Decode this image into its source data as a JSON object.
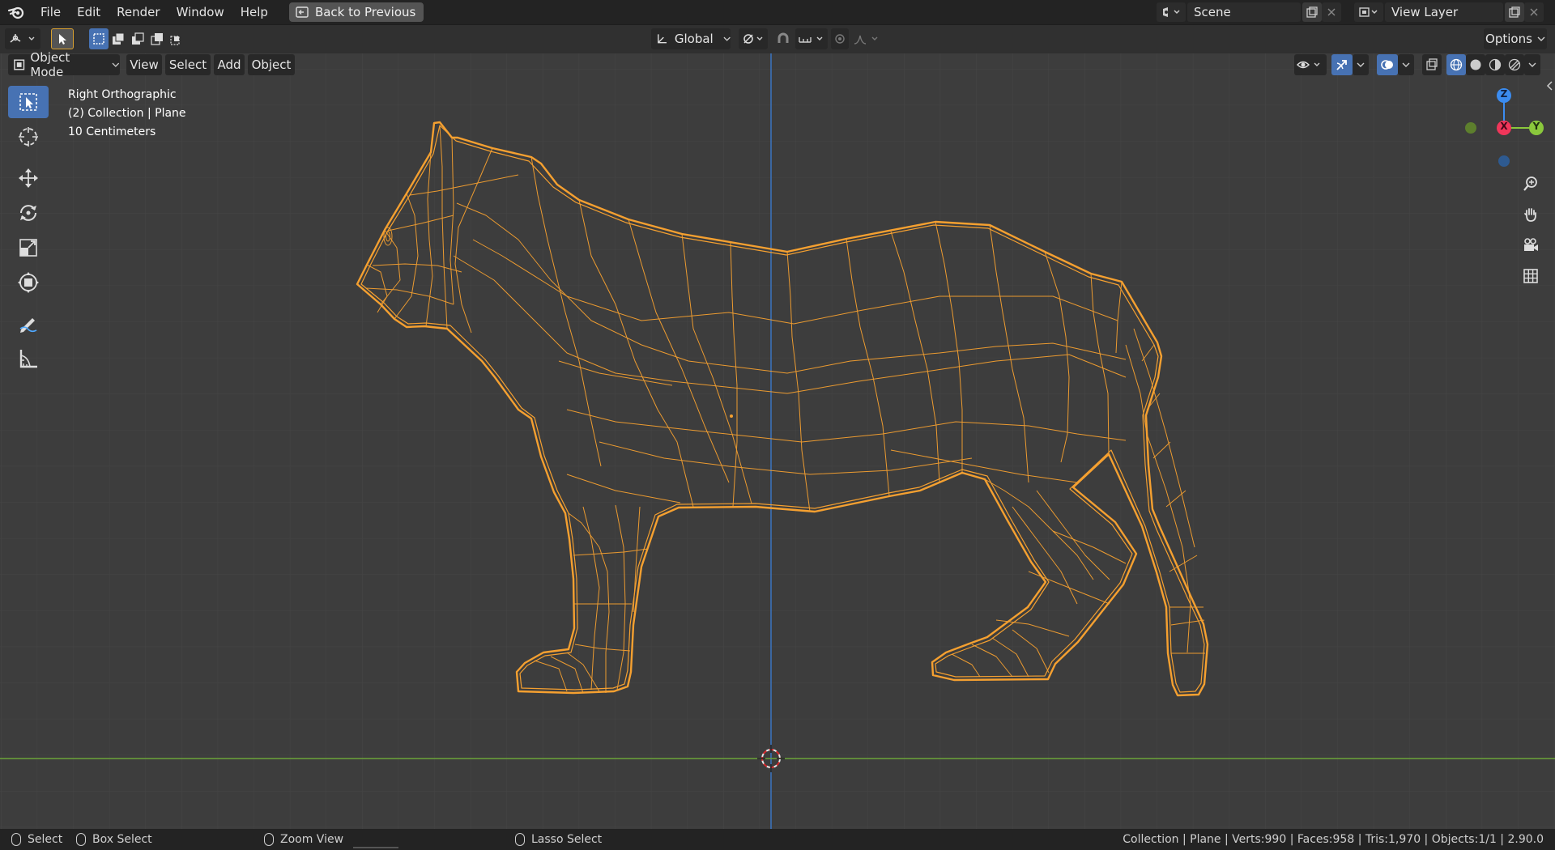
{
  "menu": {
    "items": [
      "File",
      "Edit",
      "Render",
      "Window",
      "Help"
    ],
    "back_to_previous": "Back to Previous"
  },
  "scene": {
    "label": "Scene"
  },
  "view_layer": {
    "label": "View Layer"
  },
  "toolbar_header": {
    "transform_orientation": "Global",
    "options": "Options"
  },
  "viewport_header": {
    "mode": "Object Mode",
    "menus": [
      "View",
      "Select",
      "Add",
      "Object"
    ]
  },
  "viewport_info": {
    "view_name": "Right Orthographic",
    "collection": "(2) Collection | Plane",
    "scale": "10 Centimeters"
  },
  "gizmo": {
    "z": "Z",
    "x": "X",
    "y": "Y"
  },
  "statusbar": {
    "select": "Select",
    "box_select": "Box Select",
    "zoom_view": "Zoom View",
    "lasso_select": "Lasso Select",
    "stats": "Collection | Plane | Verts:990 | Faces:958 | Tris:1,970 | Objects:1/1 | 2.90.0"
  },
  "colors": {
    "selection_orange": "#f5a030",
    "accent_blue": "#4772b3",
    "axis_x": "#f0365a",
    "axis_y": "#8ac83c",
    "axis_z": "#3b8cf0"
  }
}
